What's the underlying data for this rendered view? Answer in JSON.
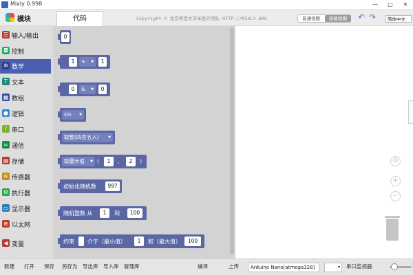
{
  "window": {
    "title": "Mixly 0.998",
    "minimize": "—",
    "maximize": "▢",
    "close": "✕"
  },
  "header": {
    "blocks_tab": "模块",
    "code_tab": "代码",
    "copyright": "Copyright © 北京师范大学米思齐团队 HTTP://MIXLY.ORG",
    "view_normal": "普通视图",
    "view_advanced": "高级视图",
    "undo_icon": "↶",
    "redo_icon": "↷",
    "language": "简体中文"
  },
  "sidebar": {
    "selected": "数学",
    "items": [
      {
        "label": "输入/输出",
        "icon": "io-icon",
        "color": "#c0392b",
        "glyph": "☰"
      },
      {
        "label": "控制",
        "icon": "gamepad-icon",
        "color": "#27ae60",
        "glyph": "◘"
      },
      {
        "label": "数学",
        "icon": "math-icon",
        "color": "#2f3e8e",
        "glyph": "✲"
      },
      {
        "label": "文本",
        "icon": "text-icon",
        "color": "#1e8b7a",
        "glyph": "T"
      },
      {
        "label": "数组",
        "icon": "array-icon",
        "color": "#3b4aa8",
        "glyph": "▦"
      },
      {
        "label": "逻辑",
        "icon": "logic-bulb-icon",
        "color": "#2c8fd1",
        "glyph": "●"
      },
      {
        "label": "串口",
        "icon": "serial-icon",
        "color": "#7bb32e",
        "glyph": "/"
      },
      {
        "label": "通信",
        "icon": "comm-icon",
        "color": "#1a8b4a",
        "glyph": "≈"
      },
      {
        "label": "存储",
        "icon": "storage-icon",
        "color": "#b03a2e",
        "glyph": "▤"
      },
      {
        "label": "传感器",
        "icon": "sensor-icon",
        "color": "#c98c1c",
        "glyph": "⚟"
      },
      {
        "label": "执行器",
        "icon": "actuator-icon",
        "color": "#27a84a",
        "glyph": "⚙"
      },
      {
        "label": "显示器",
        "icon": "display-icon",
        "color": "#2c7fb8",
        "glyph": "▭"
      },
      {
        "label": "以太网",
        "icon": "ethernet-icon",
        "color": "#c0392b",
        "glyph": "⊕"
      },
      {
        "label": "变量",
        "icon": "variable-icon",
        "color": "#b33939",
        "glyph": "◀"
      }
    ]
  },
  "blocks": {
    "number": {
      "value": "0"
    },
    "arith": {
      "a": "1",
      "op": "+",
      "b": "1"
    },
    "bitwise": {
      "a": "0",
      "op": "&",
      "b": "0"
    },
    "trig": {
      "func": "sin"
    },
    "round": {
      "func": "取整(四舍五入)"
    },
    "minmax": {
      "func": "取最大值",
      "open": "(",
      "a": "1",
      "sep": ",",
      "b": "2",
      "close": ")"
    },
    "seed": {
      "label": "初始化随机数",
      "value": "997"
    },
    "random": {
      "label": "随机整数 从",
      "from": "1",
      "to_label": "到",
      "to": "100"
    },
    "constrain": {
      "label": "约束",
      "between": "介于（最小值）",
      "min": "1",
      "and": "和（最大值）",
      "max": "100"
    }
  },
  "workspace": {
    "locate_icon": "⊙",
    "zoom_in": "+",
    "zoom_out": "−"
  },
  "toolbar": {
    "new": "新建",
    "open": "打开",
    "save": "保存",
    "save_as": "另存为",
    "export_lib": "导出库",
    "import_lib": "导入库",
    "manage_lib": "管理库",
    "compile": "编译",
    "upload": "上传",
    "board": "Arduino Nano[atmega328]",
    "port": "▾",
    "serial_monitor": "串口监视器"
  },
  "colors": {
    "math_block": "#5b67a5",
    "selected_category": "#4a5eb2",
    "accent_blue": "#4a7fd6"
  }
}
